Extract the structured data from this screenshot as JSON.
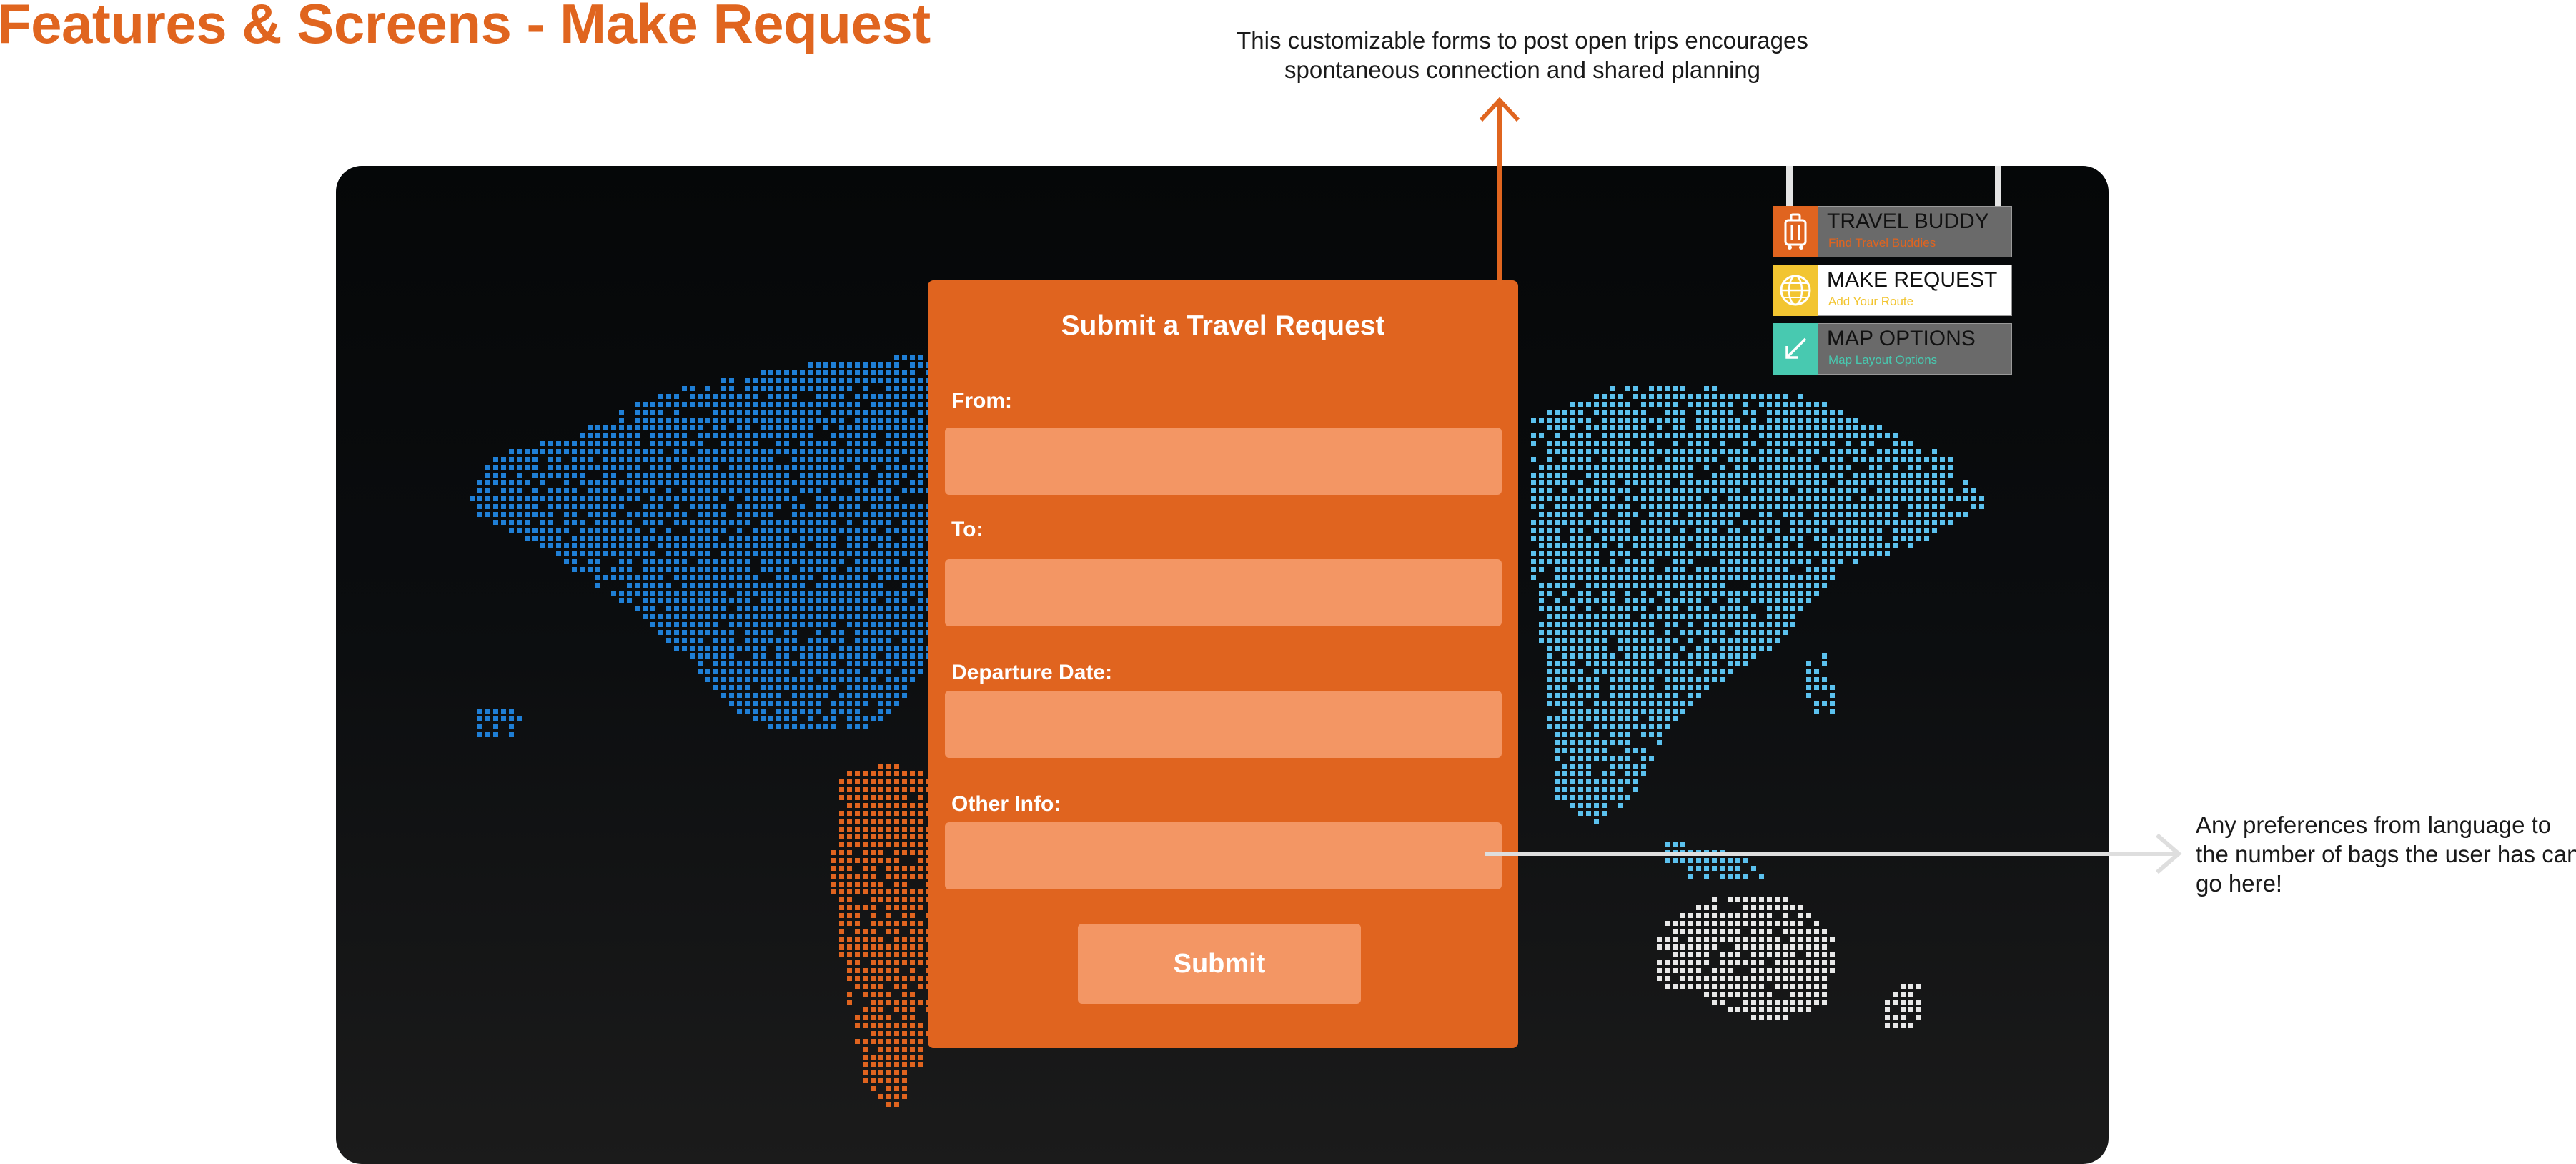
{
  "page": {
    "title": "Features & Screens - Make Request"
  },
  "annotations": {
    "top": "This customizable forms to post open trips encourages spontaneous connection and shared planning",
    "right": "Any preferences from language to the number of bags the user has can go here!"
  },
  "form": {
    "title": "Submit a Travel Request",
    "fields": [
      {
        "label": "From:",
        "value": "",
        "placeholder": ""
      },
      {
        "label": "To:",
        "value": "",
        "placeholder": ""
      },
      {
        "label": "Departure Date:",
        "value": "",
        "placeholder": ""
      },
      {
        "label": "Other Info:",
        "value": "",
        "placeholder": ""
      }
    ],
    "submit_label": "Submit"
  },
  "menu": {
    "items": [
      {
        "label": "TRAVEL BUDDY",
        "sublabel": "Find Travel Buddies",
        "icon": "luggage-icon",
        "color": "#e0641f",
        "active": false
      },
      {
        "label": "MAKE REQUEST",
        "sublabel": "Add Your Route",
        "icon": "globe-icon",
        "color": "#f2c531",
        "active": true
      },
      {
        "label": "MAP OPTIONS",
        "sublabel": "Map Layout Options",
        "icon": "arrow-diagonal-icon",
        "color": "#48c9b0",
        "active": false
      }
    ]
  },
  "map": {
    "colors": {
      "north_america": "#1f7fd6",
      "eurasia": "#5bc1ee",
      "south_america": "#e0641f",
      "oceania": "#e8e8e8"
    }
  },
  "colors": {
    "accent": "#e0651f",
    "field": "#f39664",
    "annotation_arrow_right": "#dedede"
  }
}
